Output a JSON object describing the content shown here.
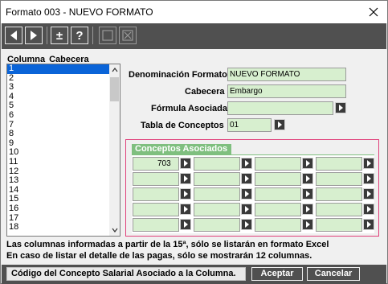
{
  "window": {
    "title": "Formato 003 - NUEVO FORMATO"
  },
  "toolbar": {
    "buttons": [
      {
        "icon": "triangle-left-icon"
      },
      {
        "icon": "triangle-right-icon"
      },
      {
        "icon": "plus-minus-icon",
        "glyph": "±"
      },
      {
        "icon": "help-icon",
        "glyph": "?"
      },
      {
        "icon": "square-icon"
      },
      {
        "icon": "square-x-icon"
      }
    ]
  },
  "list": {
    "header_col1": "Columna",
    "header_col2": "Cabecera",
    "items": [
      "1",
      "2",
      "3",
      "4",
      "5",
      "6",
      "7",
      "8",
      "9",
      "10",
      "11",
      "12",
      "13",
      "14",
      "15",
      "16",
      "17",
      "18"
    ],
    "selected_index": 0
  },
  "form": {
    "denominacion_label": "Denominación Formato",
    "denominacion_value": "NUEVO FORMATO",
    "cabecera_label": "Cabecera",
    "cabecera_value": "Embargo",
    "formula_label": "Fórmula Asociada",
    "formula_value": "",
    "tabla_label": "Tabla de Conceptos",
    "tabla_value": "01"
  },
  "concepts": {
    "tab_label": "Conceptos Asociados",
    "cells": [
      "703",
      "",
      "",
      "",
      "",
      "",
      "",
      "",
      "",
      "",
      "",
      "",
      "",
      "",
      "",
      "",
      "",
      "",
      "",
      ""
    ]
  },
  "info": {
    "line1": "Las columnas informadas a partir de la 15ª, sólo se listarán en formato Excel",
    "line2": "En caso de listar el detalle de las pagas, sólo se mostrarán 12 columnas."
  },
  "status": {
    "text": "Código del Concepto Salarial Asociado a la Columna.",
    "accept_label": "Aceptar",
    "cancel_label": "Cancelar"
  },
  "colors": {
    "field_bg": "#d7efcf",
    "toolbar_bg": "#505050",
    "tab_green": "#7fbf7f",
    "highlight_border": "#e0407a",
    "selection_blue": "#0a64d8"
  }
}
